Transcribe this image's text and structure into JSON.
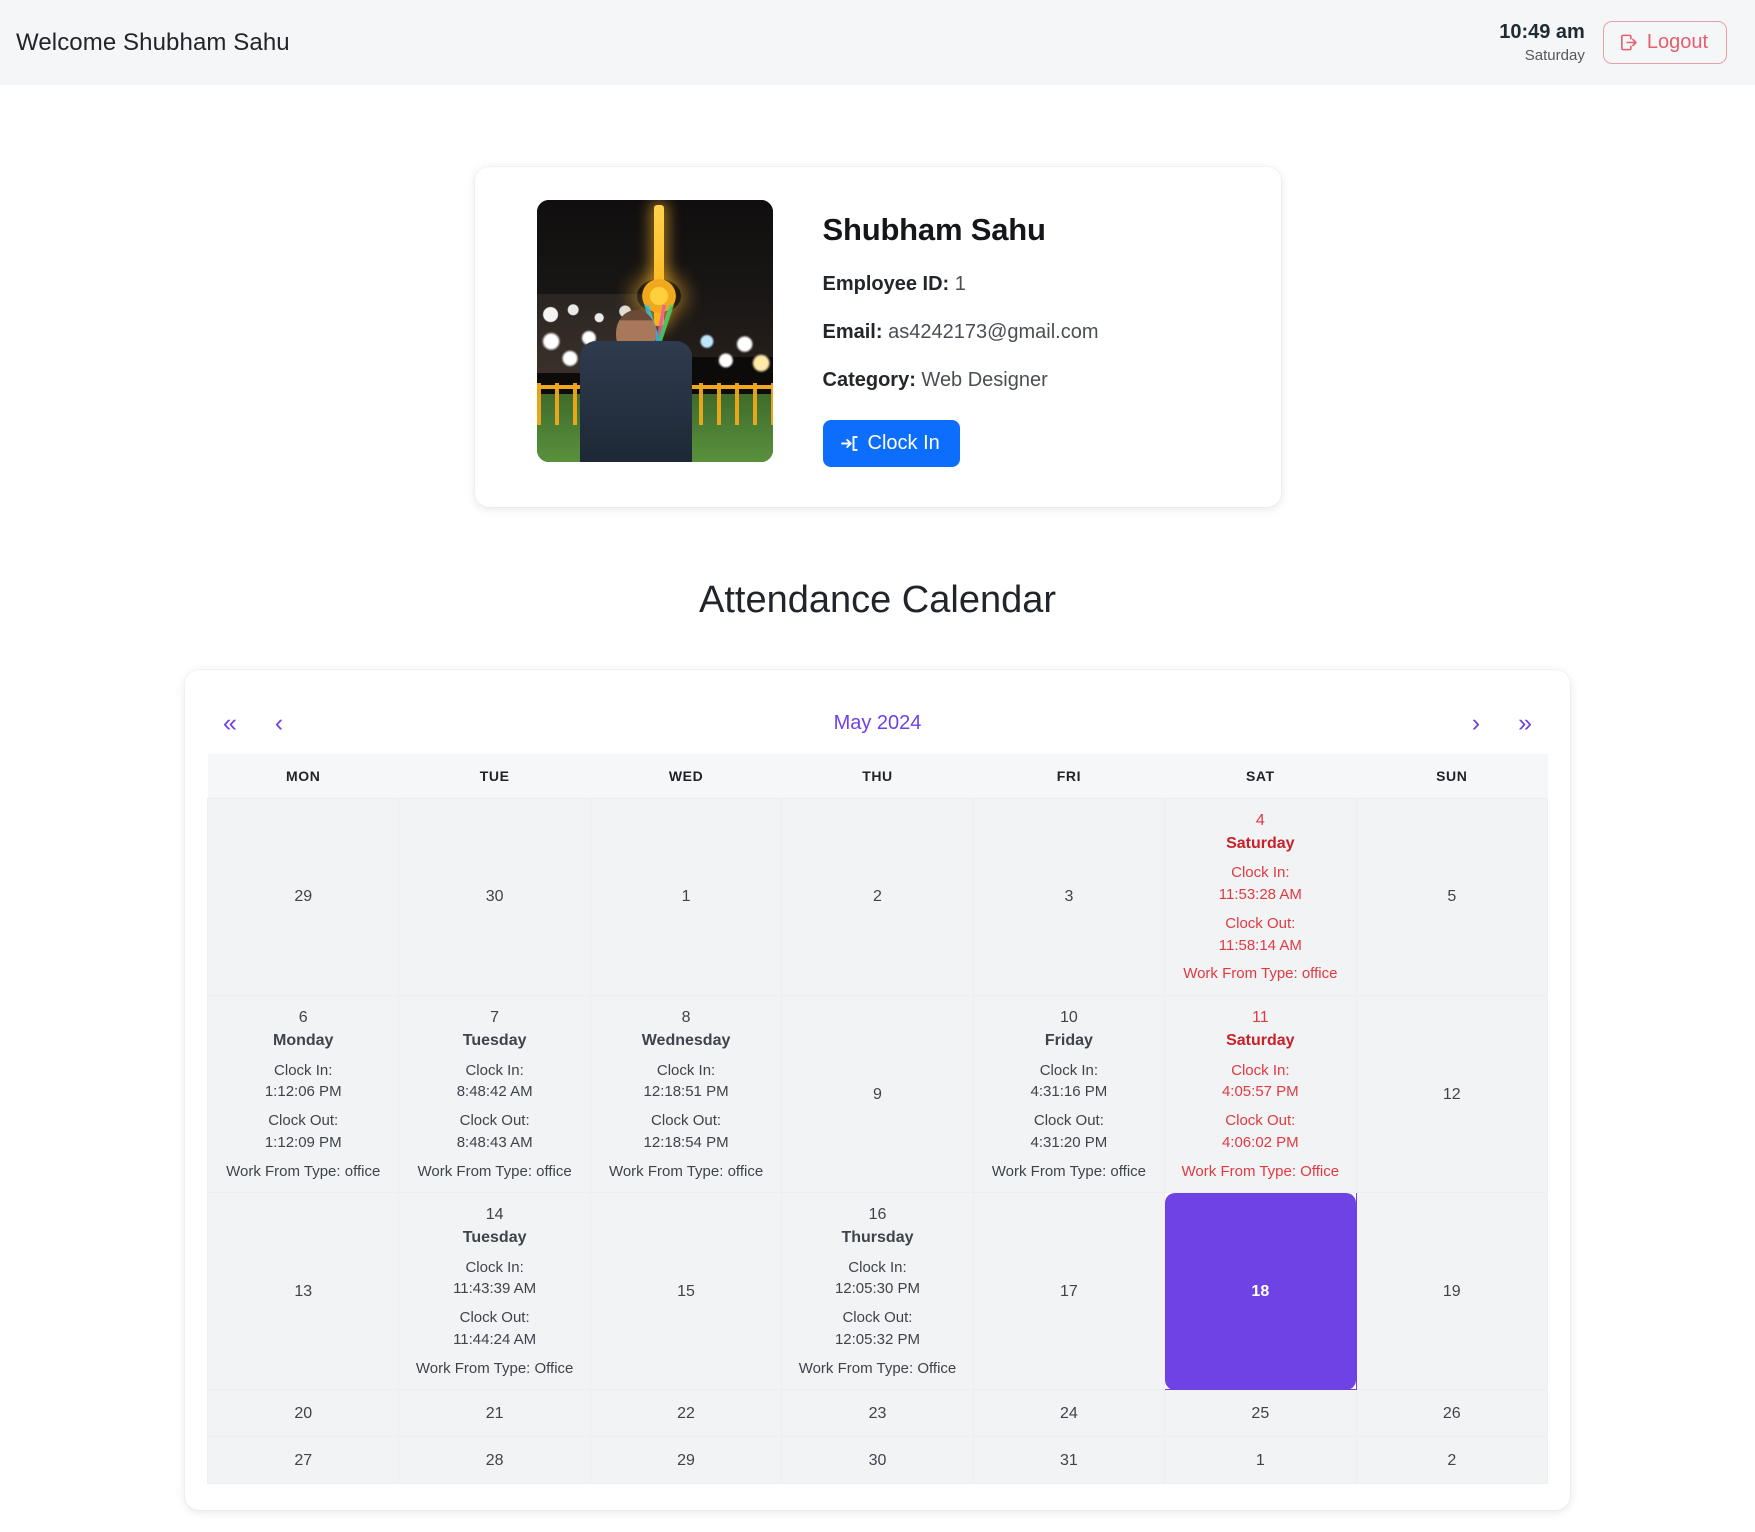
{
  "header": {
    "welcome": "Welcome Shubham Sahu",
    "time": "10:49 am",
    "day": "Saturday",
    "logout_label": "Logout"
  },
  "profile": {
    "name": "Shubham Sahu",
    "employee_id_label": "Employee ID:",
    "employee_id_value": "1",
    "email_label": "Email:",
    "email_value": "as4242173@gmail.com",
    "category_label": "Category:",
    "category_value": "Web Designer",
    "clock_in_button": "Clock In",
    "avatar_alt": "profile-photo"
  },
  "calendar": {
    "section_title": "Attendance Calendar",
    "nav": {
      "first": "«",
      "prev": "‹",
      "next": "›",
      "last": "»",
      "month_label": "May 2024"
    },
    "weekdays": [
      "MON",
      "TUE",
      "WED",
      "THU",
      "FRI",
      "SAT",
      "SUN"
    ],
    "accent_color": "#6f42e6",
    "weekend_color": "#e8404e",
    "today": "18",
    "labels": {
      "clock_in": "Clock In:",
      "clock_out": "Clock Out:"
    },
    "weeks": [
      [
        {
          "num": "29",
          "kind": "muted"
        },
        {
          "num": "30",
          "kind": "muted"
        },
        {
          "num": "1",
          "kind": "normal"
        },
        {
          "num": "2",
          "kind": "normal"
        },
        {
          "num": "3",
          "kind": "normal"
        },
        {
          "num": "4",
          "kind": "entry-red",
          "day_name": "Saturday",
          "clock_in": "11:53:28 AM",
          "clock_out": "11:58:14 AM",
          "wft": "Work From Type: office"
        },
        {
          "num": "5",
          "kind": "weekend"
        }
      ],
      [
        {
          "num": "6",
          "kind": "entry",
          "day_name": "Monday",
          "clock_in": "1:12:06 PM",
          "clock_out": "1:12:09 PM",
          "wft": "Work From Type: office"
        },
        {
          "num": "7",
          "kind": "entry",
          "day_name": "Tuesday",
          "clock_in": "8:48:42 AM",
          "clock_out": "8:48:43 AM",
          "wft": "Work From Type: office"
        },
        {
          "num": "8",
          "kind": "entry",
          "day_name": "Wednesday",
          "clock_in": "12:18:51 PM",
          "clock_out": "12:18:54 PM",
          "wft": "Work From Type: office"
        },
        {
          "num": "9",
          "kind": "normal"
        },
        {
          "num": "10",
          "kind": "entry",
          "day_name": "Friday",
          "clock_in": "4:31:16 PM",
          "clock_out": "4:31:20 PM",
          "wft": "Work From Type: office"
        },
        {
          "num": "11",
          "kind": "entry-red",
          "day_name": "Saturday",
          "clock_in": "4:05:57 PM",
          "clock_out": "4:06:02 PM",
          "wft": "Work From Type: Office"
        },
        {
          "num": "12",
          "kind": "weekend"
        }
      ],
      [
        {
          "num": "13",
          "kind": "normal"
        },
        {
          "num": "14",
          "kind": "entry",
          "day_name": "Tuesday",
          "clock_in": "11:43:39 AM",
          "clock_out": "11:44:24 AM",
          "wft": "Work From Type: Office"
        },
        {
          "num": "15",
          "kind": "normal"
        },
        {
          "num": "16",
          "kind": "entry",
          "day_name": "Thursday",
          "clock_in": "12:05:30 PM",
          "clock_out": "12:05:32 PM",
          "wft": "Work From Type: Office"
        },
        {
          "num": "17",
          "kind": "normal"
        },
        {
          "num": "18",
          "kind": "today"
        },
        {
          "num": "19",
          "kind": "weekend"
        }
      ],
      [
        {
          "num": "20",
          "kind": "normal"
        },
        {
          "num": "21",
          "kind": "normal"
        },
        {
          "num": "22",
          "kind": "normal"
        },
        {
          "num": "23",
          "kind": "normal"
        },
        {
          "num": "24",
          "kind": "normal"
        },
        {
          "num": "25",
          "kind": "weekend"
        },
        {
          "num": "26",
          "kind": "weekend"
        }
      ],
      [
        {
          "num": "27",
          "kind": "normal"
        },
        {
          "num": "28",
          "kind": "normal"
        },
        {
          "num": "29",
          "kind": "normal"
        },
        {
          "num": "30",
          "kind": "normal"
        },
        {
          "num": "31",
          "kind": "normal"
        },
        {
          "num": "1",
          "kind": "muted"
        },
        {
          "num": "2",
          "kind": "muted"
        }
      ]
    ]
  }
}
